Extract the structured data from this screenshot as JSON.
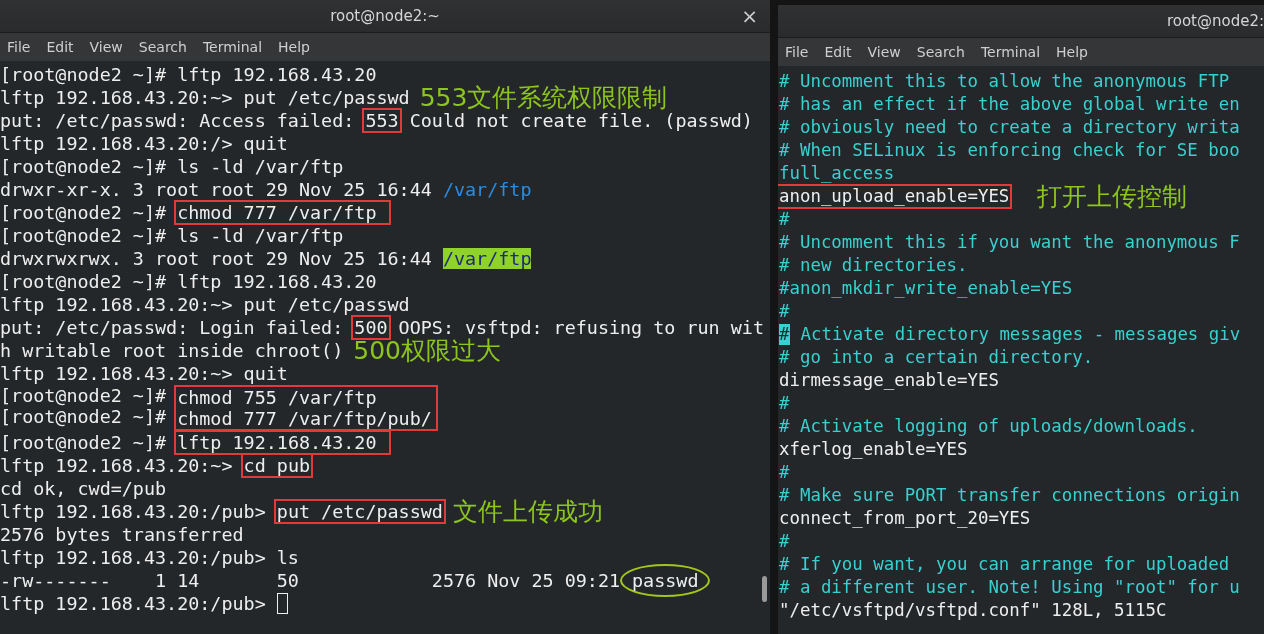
{
  "windows": [
    {
      "title": "root@node2:~",
      "close": "×",
      "menu": [
        "File",
        "Edit",
        "View",
        "Search",
        "Terminal",
        "Help"
      ],
      "lines": [
        {
          "segments": [
            {
              "kind": "text",
              "text": "[root@node2 ~]# lftp 192.168.43.20"
            }
          ]
        },
        {
          "segments": [
            {
              "kind": "text",
              "text": "lftp 192.168.43.20:~> put /etc/passwd"
            },
            {
              "kind": "note",
              "text": "553文件系统权限限制"
            }
          ]
        },
        {
          "segments": [
            {
              "kind": "text",
              "text": "put: /etc/passwd: Access failed: "
            },
            {
              "kind": "boxed",
              "text": "553"
            },
            {
              "kind": "text",
              "text": " Could not create file. (passwd)"
            }
          ]
        },
        {
          "segments": [
            {
              "kind": "text",
              "text": "lftp 192.168.43.20:/> quit"
            }
          ]
        },
        {
          "segments": [
            {
              "kind": "text",
              "text": "[root@node2 ~]# ls -ld /var/ftp"
            }
          ]
        },
        {
          "segments": [
            {
              "kind": "text",
              "text": "drwxr-xr-x. 3 root root 29 Nov 25 16:44 "
            },
            {
              "kind": "link",
              "text": "/var/ftp"
            }
          ]
        },
        {
          "segments": [
            {
              "kind": "text",
              "text": "[root@node2 ~]# "
            },
            {
              "kind": "boxed",
              "text": "chmod 777 /var/ftp "
            }
          ]
        },
        {
          "segments": [
            {
              "kind": "text",
              "text": "[root@node2 ~]# ls -ld /var/ftp"
            }
          ]
        },
        {
          "segments": [
            {
              "kind": "text",
              "text": "drwxrwxrwx. 3 root root 29 Nov 25 16:44 "
            },
            {
              "kind": "highlight",
              "text": "/var/ftp"
            }
          ]
        },
        {
          "segments": [
            {
              "kind": "text",
              "text": "[root@node2 ~]# lftp 192.168.43.20"
            }
          ]
        },
        {
          "segments": [
            {
              "kind": "text",
              "text": "lftp 192.168.43.20:~> put /etc/passwd"
            }
          ]
        },
        {
          "segments": [
            {
              "kind": "text",
              "text": "put: /etc/passwd: Login failed: "
            },
            {
              "kind": "boxed",
              "text": "500"
            },
            {
              "kind": "text",
              "text": " OOPS: vsftpd: refusing to run wit"
            }
          ]
        },
        {
          "segments": [
            {
              "kind": "text",
              "text": "h writable root inside chroot()"
            },
            {
              "kind": "note",
              "text": "500权限过大"
            }
          ]
        },
        {
          "segments": [
            {
              "kind": "text",
              "text": "lftp 192.168.43.20:~> quit"
            }
          ]
        },
        {
          "kind": "boxed_group",
          "prompts": [
            "[root@node2 ~]# ",
            "[root@node2 ~]# "
          ],
          "commands": [
            "chmod 755 /var/ftp",
            "chmod 777 /var/ftp/pub/"
          ]
        },
        {
          "segments": [
            {
              "kind": "text",
              "text": "[root@node2 ~]# "
            },
            {
              "kind": "boxed",
              "text": "lftp 192.168.43.20 "
            }
          ]
        },
        {
          "segments": [
            {
              "kind": "text",
              "text": "lftp 192.168.43.20:~> "
            },
            {
              "kind": "boxed",
              "text": "cd pub"
            }
          ]
        },
        {
          "segments": [
            {
              "kind": "text",
              "text": "cd ok, cwd=/pub"
            }
          ]
        },
        {
          "segments": [
            {
              "kind": "text",
              "text": "lftp 192.168.43.20:/pub> "
            },
            {
              "kind": "boxed",
              "text": "put /etc/passwd"
            },
            {
              "kind": "note",
              "text": "文件上传成功"
            }
          ]
        },
        {
          "segments": [
            {
              "kind": "text",
              "text": "2576 bytes transferred"
            }
          ]
        },
        {
          "segments": [
            {
              "kind": "text",
              "text": "lftp 192.168.43.20:/pub> ls"
            }
          ]
        },
        {
          "segments": [
            {
              "kind": "text",
              "text": "-rw-------    1 14       50            2576 Nov 25 09:21"
            },
            {
              "kind": "circled",
              "text": "passwd"
            }
          ]
        },
        {
          "segments": [
            {
              "kind": "text",
              "text": "lftp 192.168.43.20:/pub> "
            },
            {
              "kind": "cursor"
            }
          ]
        }
      ]
    },
    {
      "title": "root@node2:",
      "menu": [
        "File",
        "Edit",
        "View",
        "Search",
        "Terminal",
        "Help"
      ],
      "lines": [
        {
          "segments": [
            {
              "kind": "comment",
              "text": "# Uncomment this to allow the anonymous FTP"
            }
          ]
        },
        {
          "segments": [
            {
              "kind": "comment",
              "text": "# has an effect if the above global write en"
            }
          ]
        },
        {
          "segments": [
            {
              "kind": "comment",
              "text": "# obviously need to create a directory writa"
            }
          ]
        },
        {
          "segments": [
            {
              "kind": "comment",
              "text": "# When SELinux is enforcing check for SE boo"
            }
          ]
        },
        {
          "segments": [
            {
              "kind": "comment",
              "text": "full_access"
            }
          ]
        },
        {
          "segments": [
            {
              "kind": "boxed",
              "text": "anon_upload_enable=YES"
            },
            {
              "kind": "note",
              "text": "打开上传控制"
            }
          ]
        },
        {
          "segments": [
            {
              "kind": "comment",
              "text": "#"
            }
          ]
        },
        {
          "segments": [
            {
              "kind": "comment",
              "text": "# Uncomment this if you want the anonymous F"
            }
          ]
        },
        {
          "segments": [
            {
              "kind": "comment",
              "text": "# new directories."
            }
          ]
        },
        {
          "segments": [
            {
              "kind": "comment",
              "text": "#anon_mkdir_write_enable=YES"
            }
          ]
        },
        {
          "segments": [
            {
              "kind": "comment",
              "text": "#"
            }
          ]
        },
        {
          "segments": [
            {
              "kind": "cursor",
              "text": "#"
            },
            {
              "kind": "comment",
              "text": " Activate directory messages - messages giv"
            }
          ]
        },
        {
          "segments": [
            {
              "kind": "comment",
              "text": "# go into a certain directory."
            }
          ]
        },
        {
          "segments": [
            {
              "kind": "text",
              "text": "dirmessage_enable=YES"
            }
          ]
        },
        {
          "segments": [
            {
              "kind": "comment",
              "text": "#"
            }
          ]
        },
        {
          "segments": [
            {
              "kind": "comment",
              "text": "# Activate logging of uploads/downloads."
            }
          ]
        },
        {
          "segments": [
            {
              "kind": "text",
              "text": "xferlog_enable=YES"
            }
          ]
        },
        {
          "segments": [
            {
              "kind": "comment",
              "text": "#"
            }
          ]
        },
        {
          "segments": [
            {
              "kind": "comment",
              "text": "# Make sure PORT transfer connections origin"
            }
          ]
        },
        {
          "segments": [
            {
              "kind": "text",
              "text": "connect_from_port_20=YES"
            }
          ]
        },
        {
          "segments": [
            {
              "kind": "comment",
              "text": "#"
            }
          ]
        },
        {
          "segments": [
            {
              "kind": "comment",
              "text": "# If you want, you can arrange for uploaded"
            }
          ]
        },
        {
          "segments": [
            {
              "kind": "comment",
              "text": "# a different user. Note! Using \"root\" for u"
            }
          ]
        },
        {
          "segments": [
            {
              "kind": "text",
              "text": "\"/etc/vsftpd/vsftpd.conf\" 128L, 5115C"
            }
          ]
        }
      ]
    }
  ]
}
